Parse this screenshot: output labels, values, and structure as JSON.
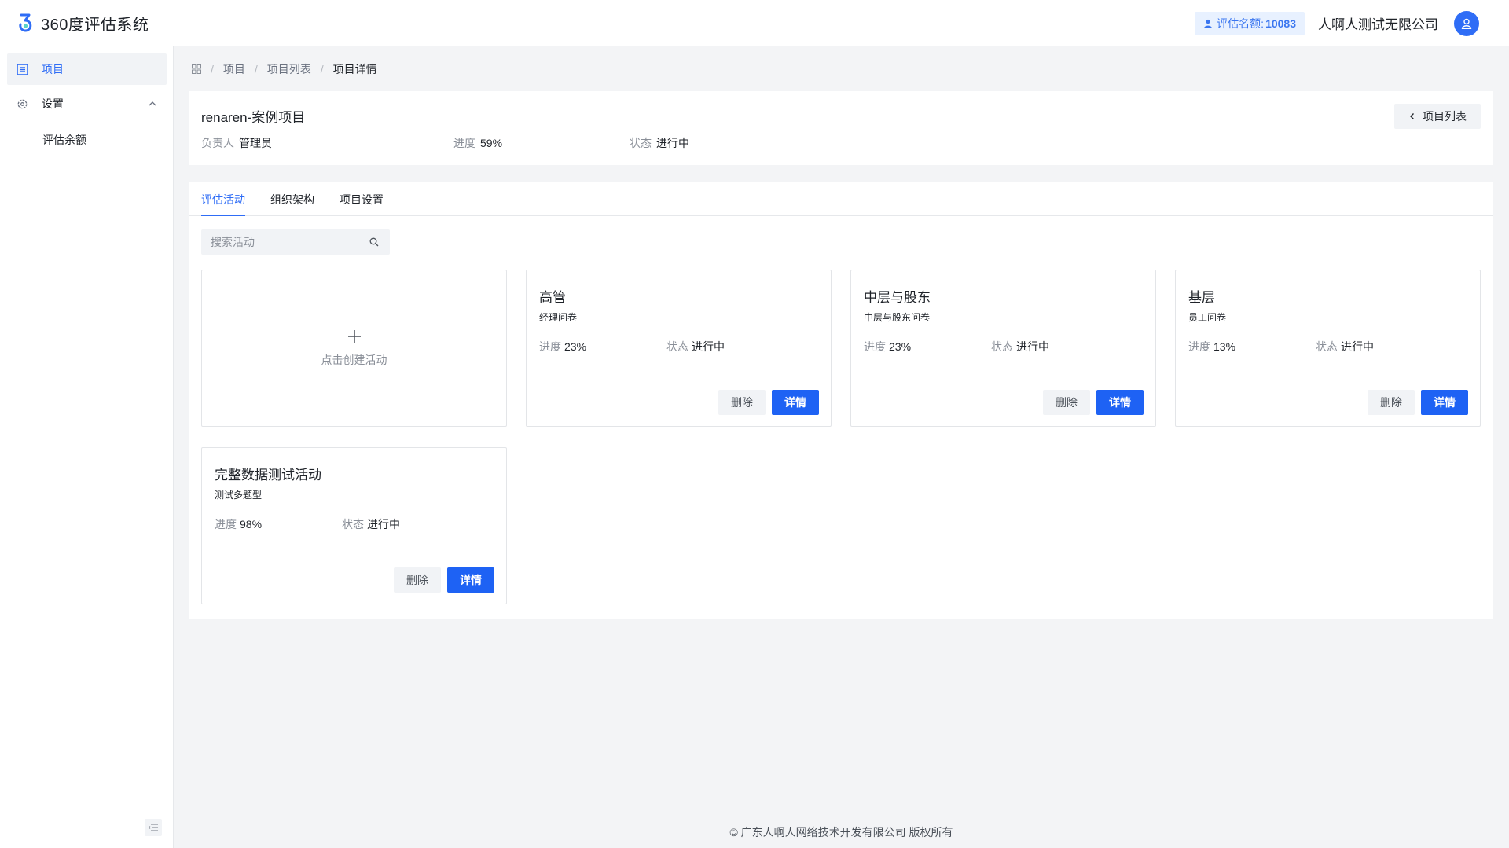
{
  "app": {
    "title": "360度评估系统"
  },
  "header": {
    "quota_label": "评估名额:",
    "quota_value": "10083",
    "company": "人啊人测试无限公司"
  },
  "sidebar": {
    "items": [
      {
        "label": "项目",
        "icon": "list-icon",
        "active": true
      },
      {
        "label": "设置",
        "icon": "gear-icon",
        "expanded": true
      }
    ],
    "sub_items": [
      {
        "label": "评估余额"
      }
    ]
  },
  "breadcrumb": {
    "items": [
      "项目",
      "项目列表"
    ],
    "current": "项目详情"
  },
  "project": {
    "title": "renaren-案例项目",
    "owner_label": "负责人",
    "owner": "管理员",
    "progress_label": "进度",
    "progress": "59%",
    "status_label": "状态",
    "status": "进行中",
    "back_label": "项目列表"
  },
  "tabs": [
    {
      "label": "评估活动",
      "active": true
    },
    {
      "label": "组织架构"
    },
    {
      "label": "项目设置"
    }
  ],
  "search": {
    "placeholder": "搜索活动",
    "value": ""
  },
  "create_card": {
    "label": "点击创建活动"
  },
  "activities": [
    {
      "title": "高管",
      "questionnaire": "经理问卷",
      "progress": "23%",
      "status": "进行中"
    },
    {
      "title": "中层与股东",
      "questionnaire": "中层与股东问卷",
      "progress": "23%",
      "status": "进行中"
    },
    {
      "title": "基层",
      "questionnaire": "员工问卷",
      "progress": "13%",
      "status": "进行中"
    },
    {
      "title": "完整数据测试活动",
      "questionnaire": "测试多题型",
      "progress": "98%",
      "status": "进行中"
    }
  ],
  "labels": {
    "progress": "进度",
    "status": "状态",
    "delete": "删除",
    "detail": "详情"
  },
  "footer": {
    "text": "© 广东人啊人网络技术开发有限公司 版权所有"
  },
  "colors": {
    "primary": "#1e62f4",
    "quota_bg": "#e8f1ff"
  }
}
